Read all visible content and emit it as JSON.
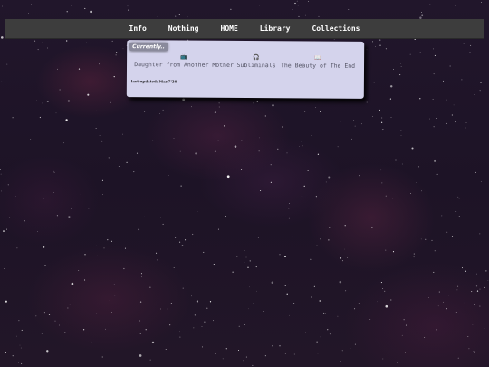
{
  "nav": {
    "items": [
      {
        "label": "Info"
      },
      {
        "label": "Nothing"
      },
      {
        "label": "HOME"
      },
      {
        "label": "Library"
      },
      {
        "label": "Collections"
      }
    ]
  },
  "card": {
    "title": "Currently..",
    "items": [
      {
        "icon": "tv-icon",
        "glyph": "📺",
        "text": "Daughter from Another Mother"
      },
      {
        "icon": "headphones-icon",
        "glyph": "🎧",
        "text": "Subliminals"
      },
      {
        "icon": "open-book-icon",
        "glyph": "📖",
        "text": "The Beauty of The End"
      }
    ],
    "updated": "last updated: Mar.7'20"
  },
  "colors": {
    "background": "#1c1226",
    "navbar": "#3d3d3d",
    "card": "#d4d3ec",
    "card_text": "#555566"
  }
}
